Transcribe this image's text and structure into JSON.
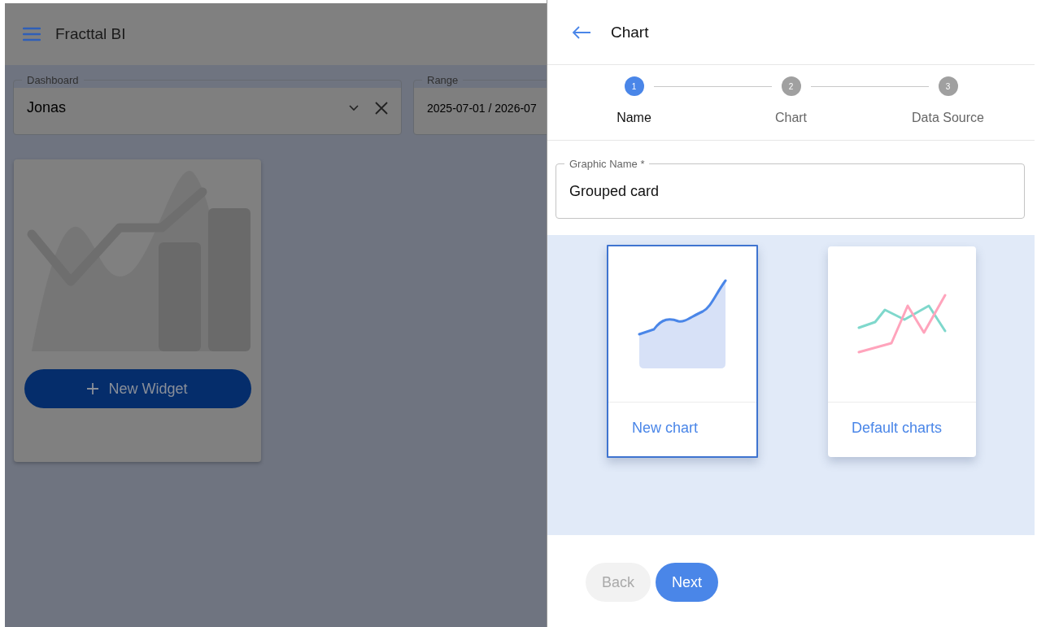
{
  "app_bar": {
    "title": "Fracttal BI"
  },
  "filters": [
    {
      "kind": "select",
      "label": "Dashboard",
      "value": "Jonas"
    },
    {
      "kind": "range",
      "label": "Range",
      "value": "2025-07-01 / 2026-07"
    }
  ],
  "widget_card": {
    "button": "New Widget"
  },
  "drawer": {
    "title": "Chart",
    "steps": [
      {
        "number": "1",
        "label": "Name",
        "selected": true
      },
      {
        "number": "2",
        "label": "Chart",
        "selected": false
      },
      {
        "number": "3",
        "label": "Data Source",
        "selected": false
      }
    ],
    "field": {
      "label": "Graphic Name *",
      "value": "Grouped card"
    },
    "options": [
      {
        "kind": "area",
        "label": "New chart",
        "selected": true
      },
      {
        "kind": "lines",
        "label": "Default charts",
        "selected": false
      }
    ],
    "buttons": [
      {
        "label": "Back",
        "disabled": true
      },
      {
        "label": "Next",
        "disabled": false
      }
    ]
  }
}
